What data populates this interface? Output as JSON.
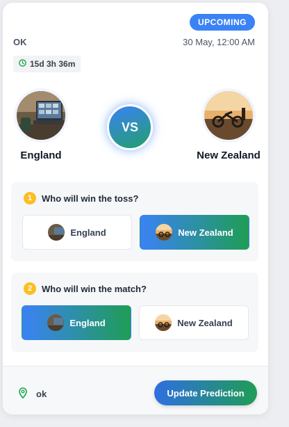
{
  "header": {
    "status_badge": "UPCOMING",
    "match_label": "OK",
    "datetime": "30 May, 12:00 AM",
    "countdown": "15d 3h 36m"
  },
  "teams": {
    "left": {
      "name": "England"
    },
    "right": {
      "name": "New Zealand"
    },
    "vs_label": "VS"
  },
  "questions": [
    {
      "number": "1",
      "text": "Who will win the toss?",
      "options": [
        {
          "label": "England",
          "selected": false
        },
        {
          "label": "New Zealand",
          "selected": true
        }
      ]
    },
    {
      "number": "2",
      "text": "Who will win the match?",
      "options": [
        {
          "label": "England",
          "selected": true
        },
        {
          "label": "New Zealand",
          "selected": false
        }
      ]
    }
  ],
  "footer": {
    "venue": "ok",
    "update_button": "Update Prediction"
  },
  "colors": {
    "accent_blue": "#3b82f6",
    "accent_green": "#1f9d55",
    "number_badge": "#fbbf24"
  }
}
